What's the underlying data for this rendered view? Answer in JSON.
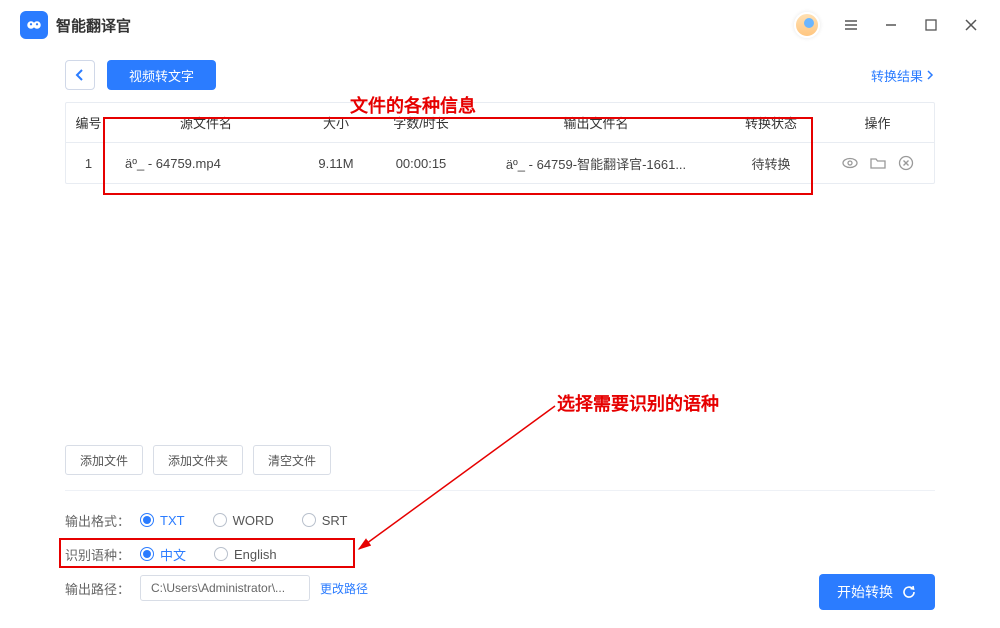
{
  "app": {
    "title": "智能翻译官"
  },
  "toolbar": {
    "mode": "视频转文字",
    "results": "转换结果"
  },
  "annotations": {
    "file_info": "文件的各种信息",
    "select_lang": "选择需要识别的语种"
  },
  "table": {
    "headers": {
      "idx": "编号",
      "src": "源文件名",
      "size": "大小",
      "dur": "字数/时长",
      "out": "输出文件名",
      "status": "转换状态",
      "ops": "操作"
    },
    "rows": [
      {
        "idx": "1",
        "src": "äº_ - 64759.mp4",
        "size": "9.11M",
        "dur": "00:00:15",
        "out": "äº_ - 64759-智能翻译官-1661...",
        "status": "待转换"
      }
    ]
  },
  "file_actions": {
    "add_file": "添加文件",
    "add_folder": "添加文件夹",
    "clear": "清空文件"
  },
  "options": {
    "format_label": "输出格式：",
    "formats": [
      "TXT",
      "WORD",
      "SRT"
    ],
    "lang_label": "识别语种：",
    "langs": [
      "中文",
      "English"
    ],
    "path_label": "输出路径：",
    "path_value": "C:\\Users\\Administrator\\...",
    "change_path": "更改路径"
  },
  "start": "开始转换"
}
